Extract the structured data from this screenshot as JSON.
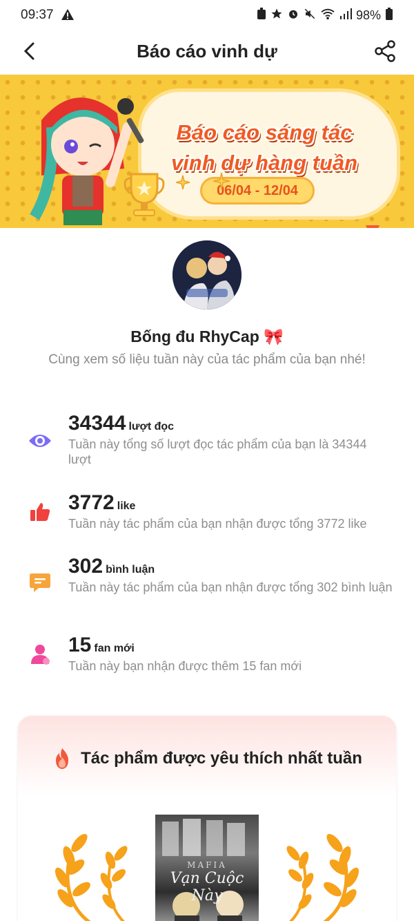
{
  "status_bar": {
    "time": "09:37",
    "battery": "98%"
  },
  "app_bar": {
    "title": "Báo cáo vinh dự"
  },
  "banner": {
    "title_line1": "Báo cáo sáng tác",
    "title_line2": "vinh dự hàng tuần",
    "date_range": "06/04 - 12/04"
  },
  "profile": {
    "username": "Bống đu RhyCap",
    "username_suffix": "🎀",
    "subtitle": "Cùng xem số liệu tuần này của tác phẩm của bạn nhé!"
  },
  "stats": [
    {
      "value": "34344",
      "unit": "lượt đọc",
      "desc": "Tuần này tổng số lượt đọc tác phẩm của bạn là 34344 lượt"
    },
    {
      "value": "3772",
      "unit": "like",
      "desc": "Tuần này tác phẩm của bạn nhận được tổng 3772 like"
    },
    {
      "value": "302",
      "unit": "bình luận",
      "desc": "Tuần này tác phẩm của bạn nhận được tổng 302 bình luận"
    },
    {
      "value": "15",
      "unit": "fan mới",
      "desc": "Tuần này bạn nhận được thêm 15 fan mới"
    }
  ],
  "top_work": {
    "title": "Tác phẩm được yêu thích nhất tuần",
    "cover_text1": "MAFIA",
    "cover_text2": "Vạn Cuộc Này"
  },
  "colors": {
    "views": "#7b6cf6",
    "likes": "#f0413e",
    "comments": "#f6a53a",
    "fans": "#f0489a",
    "banner": "#f8c93b"
  }
}
